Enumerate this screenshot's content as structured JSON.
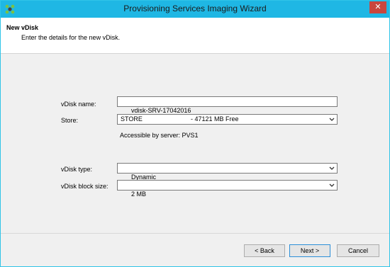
{
  "window": {
    "title": "Provisioning Services Imaging Wizard",
    "close_glyph": "✕"
  },
  "header": {
    "title": "New vDisk",
    "subtitle": "Enter the details for the new vDisk."
  },
  "form": {
    "vdisk_name_label": "vDisk name:",
    "vdisk_name_value": "vdisk-SRV-17042016",
    "store_label": "Store:",
    "store_value": "STORE",
    "store_free": "- 47121 MB Free",
    "store_note": "Accessible by server: PVS1",
    "vdisk_type_label": "vDisk type:",
    "vdisk_type_value": "Dynamic",
    "block_size_label": "vDisk block size:",
    "block_size_value": "2 MB"
  },
  "buttons": {
    "back": "< Back",
    "next": "Next >",
    "cancel": "Cancel"
  },
  "icons": {
    "app": "citrix-app-icon",
    "dropdown": "chevron-down-icon",
    "close": "close-icon"
  },
  "colors": {
    "titlebar": "#1fb7e4",
    "close_button": "#c9463d",
    "content_bg": "#f0f0f0",
    "primary_border": "#2c8fd8"
  }
}
